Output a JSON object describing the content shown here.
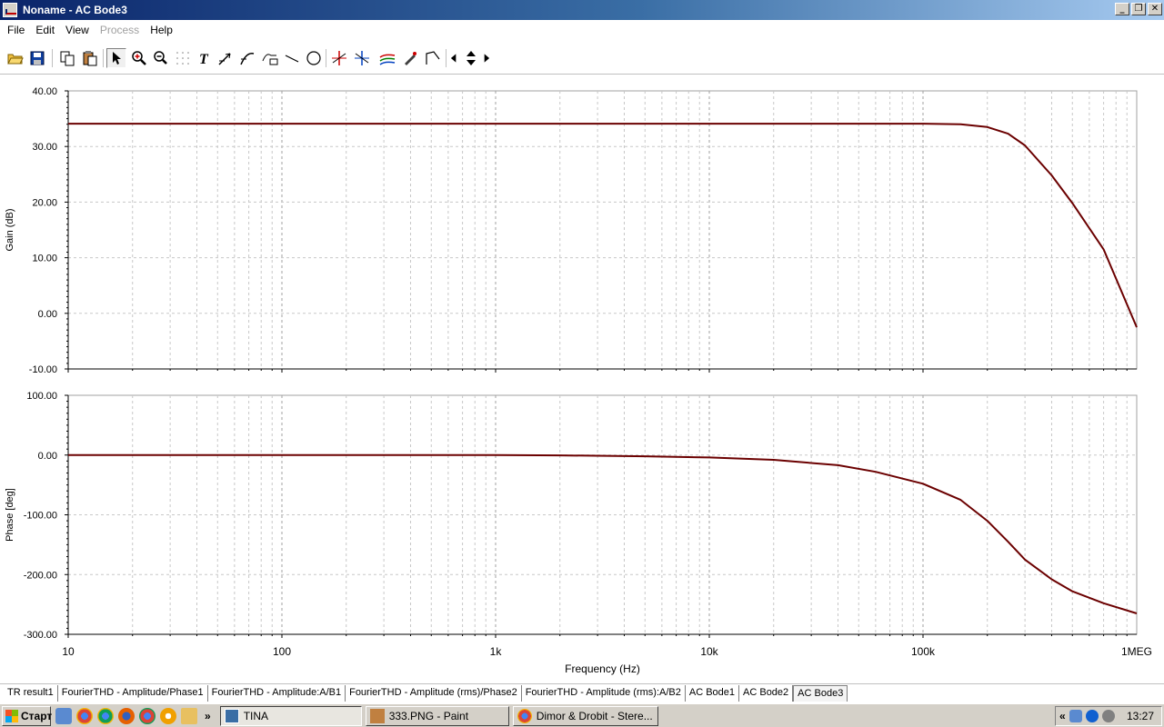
{
  "window": {
    "title": "Noname - AC Bode3",
    "controls": [
      "_",
      "❐",
      "✕"
    ]
  },
  "menu": [
    {
      "label": "File",
      "enabled": true
    },
    {
      "label": "Edit",
      "enabled": true
    },
    {
      "label": "View",
      "enabled": true
    },
    {
      "label": "Process",
      "enabled": false
    },
    {
      "label": "Help",
      "enabled": true
    }
  ],
  "toolbar": [
    "open-icon",
    "save-icon",
    "copy-icon",
    "paste-icon",
    "pointer-icon",
    "zoom-in-icon",
    "zoom-100-icon",
    "grid-icon",
    "text-icon",
    "arrow-tool-icon",
    "curve-tool-icon",
    "label-tool-icon",
    "line-icon",
    "circle-icon",
    "cursor-a-icon",
    "cursor-b-icon",
    "curve-select-icon",
    "pen-icon",
    "marker-icon",
    "nav-left-icon",
    "nav-updown-icon",
    "nav-right-icon"
  ],
  "chart_data": [
    {
      "type": "line",
      "title": "",
      "xlabel": "",
      "ylabel": "Gain (dB)",
      "xscale": "log",
      "xlim": [
        10,
        1000000
      ],
      "ylim": [
        -10,
        40
      ],
      "yticks": [
        "40.00",
        "30.00",
        "20.00",
        "10.00",
        "0.00",
        "-10.00"
      ],
      "grid": true,
      "color": "#6b0000",
      "series": [
        {
          "x": [
            10,
            100,
            1000,
            10000,
            100000,
            150000,
            200000,
            250000,
            300000,
            400000,
            500000,
            700000,
            1000000
          ],
          "values": [
            34.1,
            34.1,
            34.1,
            34.1,
            34.1,
            34.0,
            33.5,
            32.3,
            30.2,
            24.8,
            19.8,
            11.5,
            -2.5
          ]
        }
      ]
    },
    {
      "type": "line",
      "title": "",
      "xlabel": "Frequency (Hz)",
      "ylabel": "Phase [deg]",
      "xscale": "log",
      "xlim": [
        10,
        1000000
      ],
      "ylim": [
        -300,
        100
      ],
      "yticks": [
        "100.00",
        "0.00",
        "-100.00",
        "-200.00",
        "-300.00"
      ],
      "xticks": [
        "10",
        "100",
        "1k",
        "10k",
        "100k",
        "1MEG"
      ],
      "grid": true,
      "color": "#6b0000",
      "series": [
        {
          "x": [
            10,
            100,
            1000,
            2000,
            5000,
            10000,
            20000,
            40000,
            60000,
            100000,
            150000,
            200000,
            250000,
            300000,
            400000,
            500000,
            700000,
            1000000
          ],
          "values": [
            0,
            0,
            0,
            -0.5,
            -2,
            -4,
            -8,
            -17,
            -28,
            -48,
            -75,
            -110,
            -145,
            -175,
            -208,
            -228,
            -248,
            -265
          ]
        }
      ]
    }
  ],
  "tabs": [
    {
      "label": "TR result1",
      "active": false
    },
    {
      "label": "FourierTHD - Amplitude/Phase1",
      "active": false
    },
    {
      "label": "FourierTHD - Amplitude:A/B1",
      "active": false
    },
    {
      "label": "FourierTHD - Amplitude (rms)/Phase2",
      "active": false
    },
    {
      "label": "FourierTHD - Amplitude (rms):A/B2",
      "active": false
    },
    {
      "label": "AC Bode1",
      "active": false
    },
    {
      "label": "AC Bode2",
      "active": false
    },
    {
      "label": "AC Bode3",
      "active": true
    }
  ],
  "taskbar": {
    "start_label": "Старт",
    "overflow": "»",
    "tasks": [
      {
        "label": "TINA",
        "active": true,
        "icon": "tina-icon",
        "color": "#3a6ea5"
      },
      {
        "label": "333.PNG - Paint",
        "active": false,
        "icon": "paint-icon",
        "color": "#c08040"
      },
      {
        "label": "Dimor & Drobit - Stere...",
        "active": false,
        "icon": "chrome-icon",
        "color": "#db4437"
      }
    ],
    "tray_chevron": "«",
    "clock": "13:27"
  }
}
